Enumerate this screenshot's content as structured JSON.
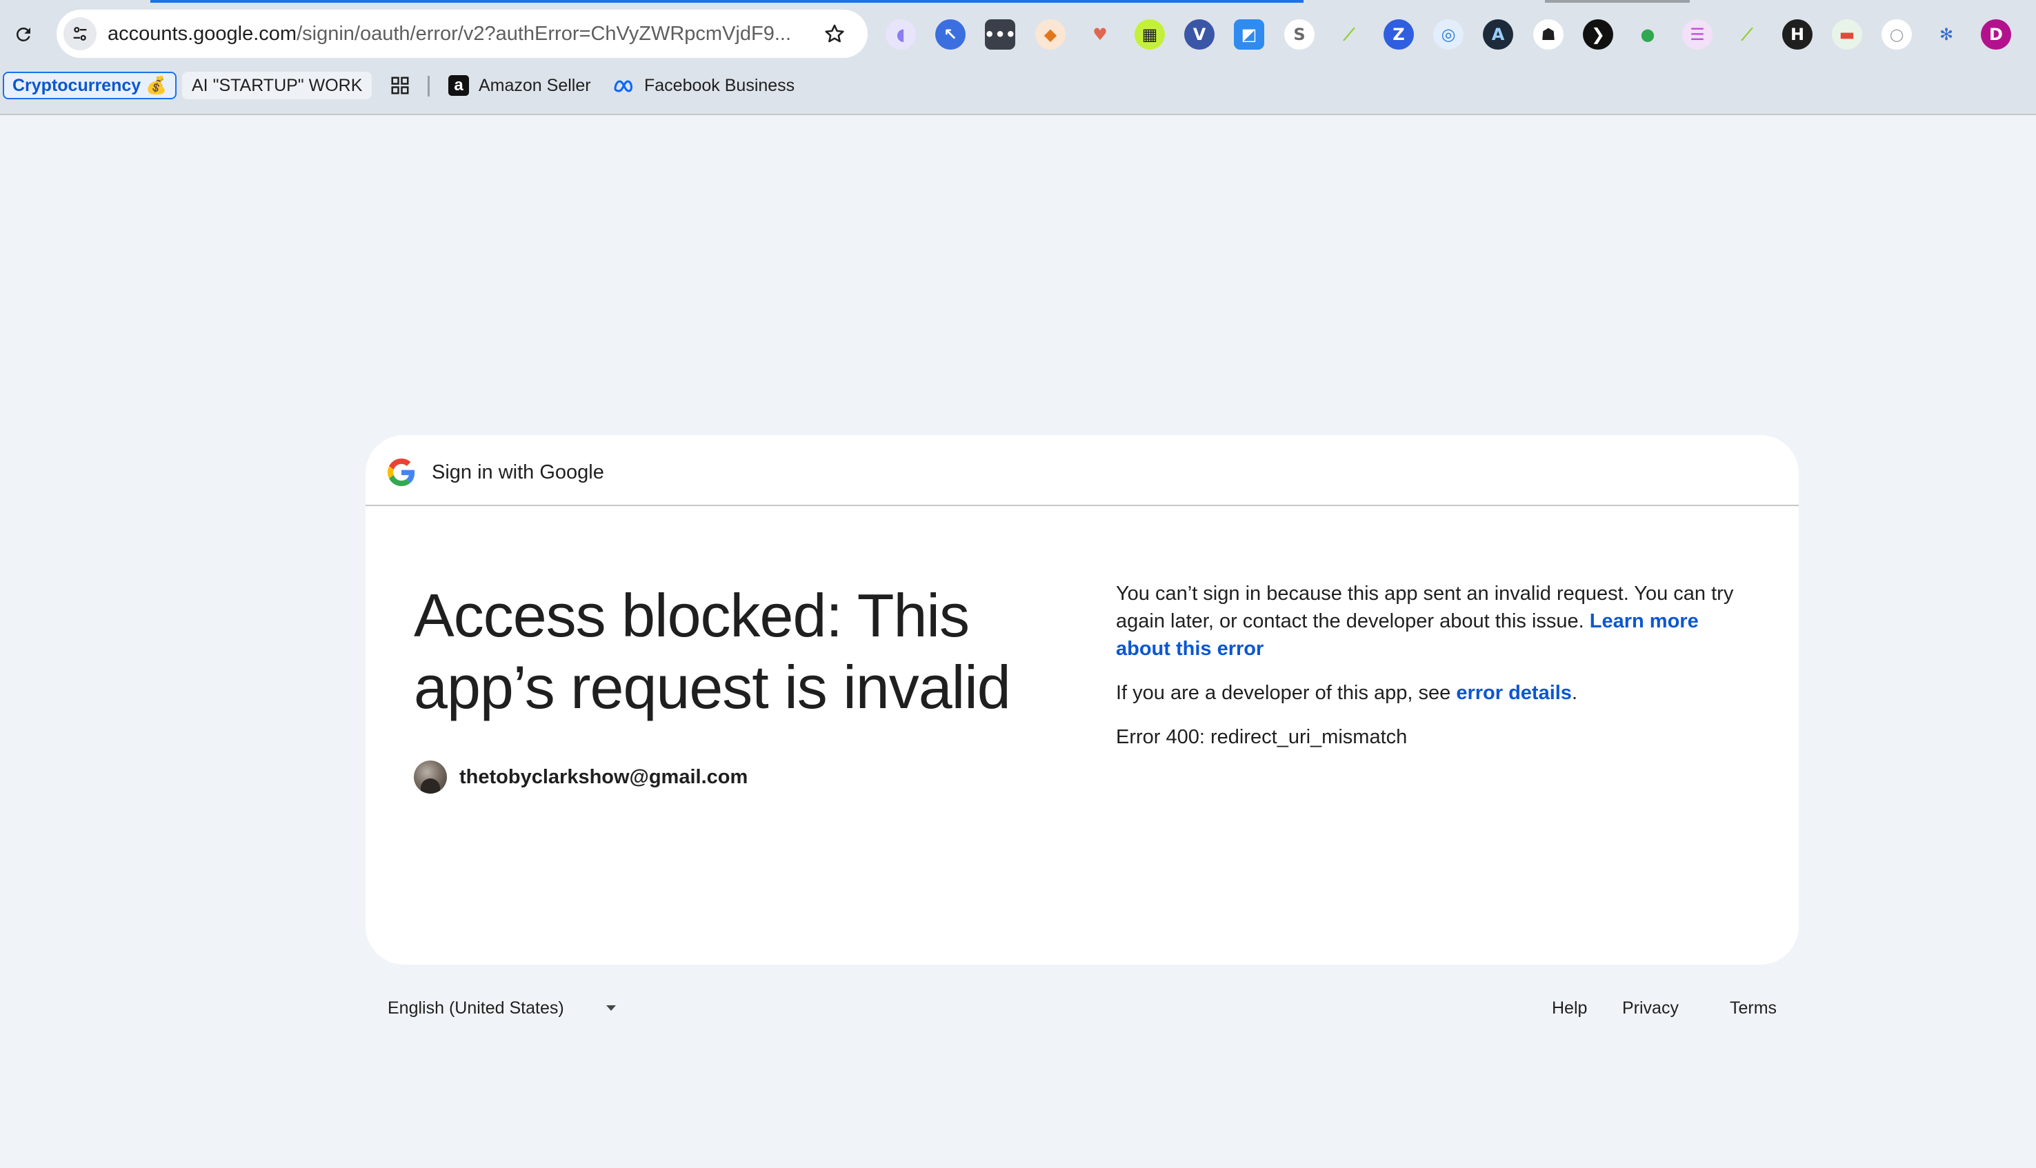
{
  "browser": {
    "url_host": "accounts.google.com",
    "url_path": "/signin/oauth/error/v2?authError=ChVyZWRpcmVjdF9...",
    "extensions": [
      {
        "name": "rabbit-extension-icon",
        "glyph": "◖",
        "color": "#8b7ef0",
        "bg": "#e8e4fb"
      },
      {
        "name": "cursor-extension-icon",
        "glyph": "↖",
        "color": "#ffffff",
        "bg": "#3b6fe0"
      },
      {
        "name": "dots-extension-icon",
        "glyph": "•••",
        "color": "#ffffff",
        "bg": "#3a3f4a"
      },
      {
        "name": "metamask-extension-icon",
        "glyph": "◆",
        "color": "#e2761b",
        "bg": "#fbe6d4"
      },
      {
        "name": "heart-extension-icon",
        "glyph": "♥",
        "color": "#e0664f",
        "bg": "transparent"
      },
      {
        "name": "grid-extension-icon",
        "glyph": "▦",
        "color": "#1d1d1d",
        "bg": "#c5f03a"
      },
      {
        "name": "v-extension-icon",
        "glyph": "V",
        "color": "#ffffff",
        "bg": "#3a56a6"
      },
      {
        "name": "square-extension-icon",
        "glyph": "◩",
        "color": "#ffffff",
        "bg": "#2f8bf0"
      },
      {
        "name": "s-extension-icon",
        "glyph": "S",
        "color": "#6b6b6b",
        "bg": "#ffffff"
      },
      {
        "name": "leaf-extension-icon",
        "glyph": "⟋",
        "color": "#8bd12a",
        "bg": "transparent"
      },
      {
        "name": "z-extension-icon",
        "glyph": "Z",
        "color": "#ffffff",
        "bg": "#2f5fe0"
      },
      {
        "name": "compass-extension-icon",
        "glyph": "◎",
        "color": "#2d7be0",
        "bg": "#e3eefc"
      },
      {
        "name": "pen-extension-icon",
        "glyph": "A",
        "color": "#9ad0ff",
        "bg": "#1c2a3a"
      },
      {
        "name": "shield-extension-icon",
        "glyph": "☗",
        "color": "#1f1f1f",
        "bg": "#ffffff"
      },
      {
        "name": "arrow-extension-icon",
        "glyph": "❯",
        "color": "#ffffff",
        "bg": "#111111"
      },
      {
        "name": "frog-extension-icon",
        "glyph": "●",
        "color": "#2fa84f",
        "bg": "transparent"
      },
      {
        "name": "list-extension-icon",
        "glyph": "☰",
        "color": "#c04fd8",
        "bg": "#f2e1f8"
      },
      {
        "name": "sprout-extension-icon",
        "glyph": "⟋",
        "color": "#8bd12a",
        "bg": "transparent"
      },
      {
        "name": "hh-extension-icon",
        "glyph": "H",
        "color": "#ffffff",
        "bg": "#1f1f1f"
      },
      {
        "name": "flag-extension-icon",
        "glyph": "▬",
        "color": "#e04a3a",
        "bg": "#e8f4e8"
      },
      {
        "name": "cloud-extension-icon",
        "glyph": "○",
        "color": "#9aa0a6",
        "bg": "#ffffff"
      },
      {
        "name": "gear-extension-icon",
        "glyph": "✻",
        "color": "#3c6fd0",
        "bg": "transparent"
      },
      {
        "name": "d-extension-icon",
        "glyph": "D",
        "color": "#ffffff",
        "bg": "#b3128c"
      }
    ]
  },
  "bookmarks": {
    "crypto": "Cryptocurrency 💰",
    "ai": "AI \"STARTUP\" WORK",
    "amazon": "Amazon Seller",
    "facebook": "Facebook Business"
  },
  "card": {
    "header_title": "Sign in with Google",
    "headline": "Access blocked: This app’s request is invalid",
    "account_email": "thetobyclarkshow@gmail.com",
    "info_p1_text": "You can’t sign in because this app sent an invalid request. You can try again later, or contact the developer about this issue. ",
    "info_p1_link": "Learn more about this error",
    "info_p2_text": "If you are a developer of this app, see ",
    "info_p2_link": "error details",
    "info_p2_end": ".",
    "error_code": "Error 400: redirect_uri_mismatch"
  },
  "footer": {
    "language": "English (United States)",
    "help": "Help",
    "privacy": "Privacy",
    "terms": "Terms"
  },
  "colors": {
    "page_bg": "#f0f4f9",
    "link": "#0b57d0",
    "chrome_bg": "#dde3ea"
  }
}
